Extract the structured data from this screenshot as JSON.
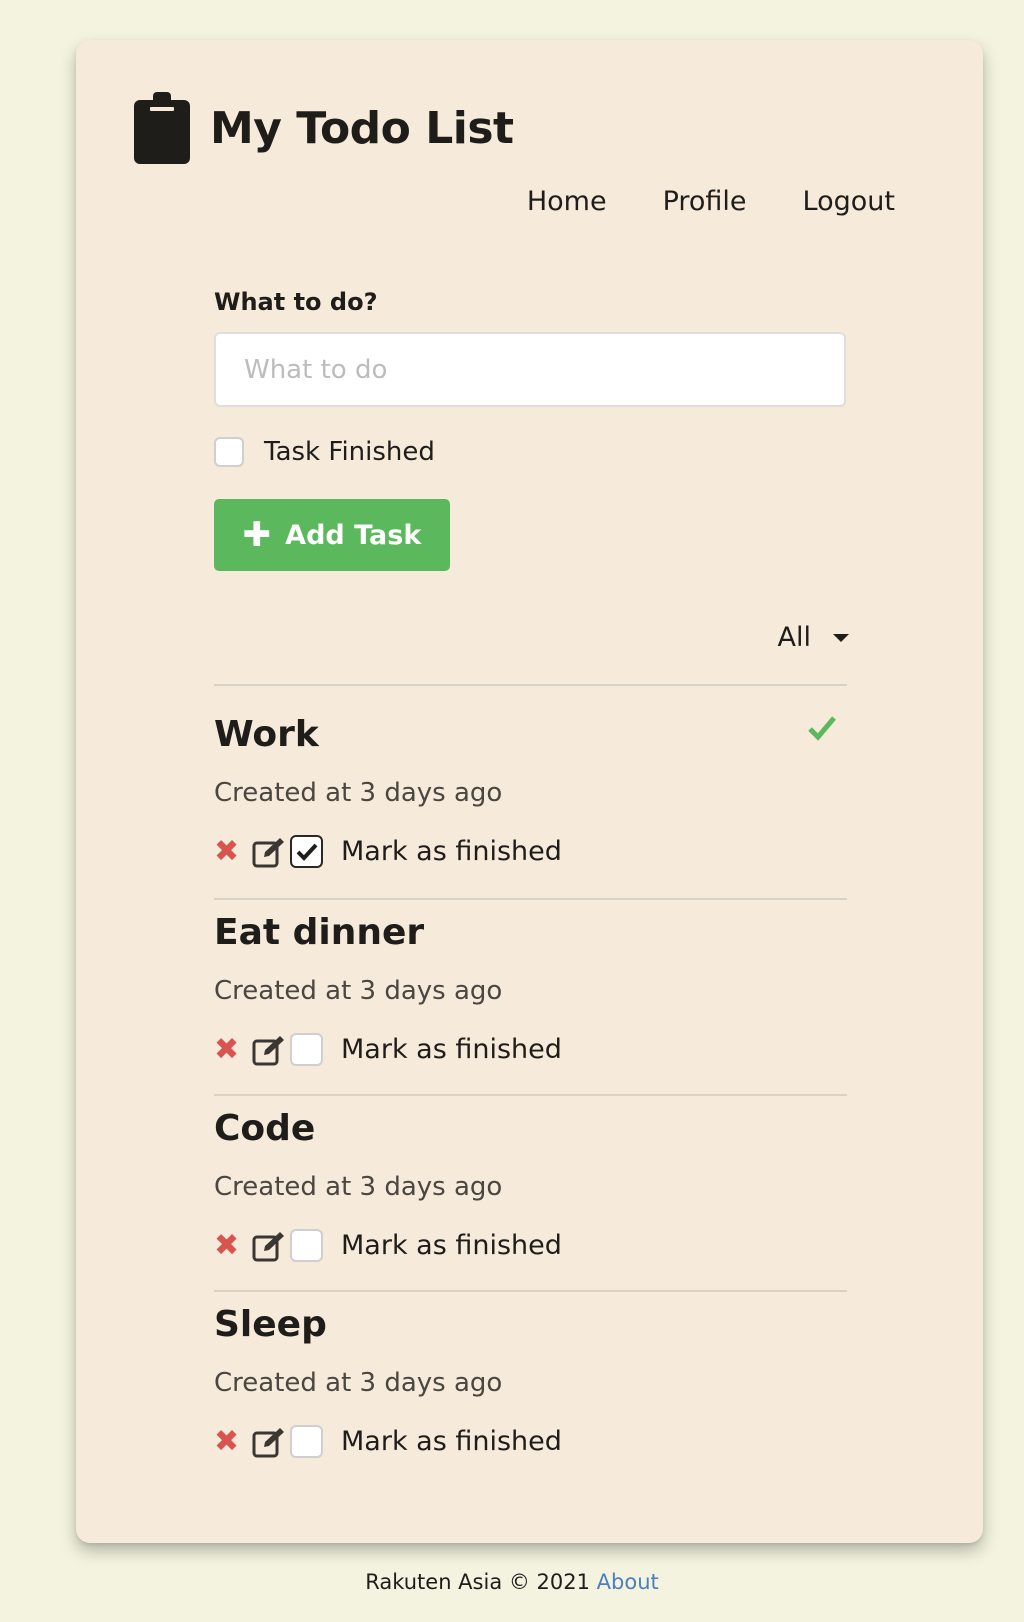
{
  "app": {
    "title": "My Todo List"
  },
  "nav": {
    "home": "Home",
    "profile": "Profile",
    "logout": "Logout"
  },
  "form": {
    "label": "What to do?",
    "placeholder": "What to do",
    "finished_label": "Task Finished",
    "finished_checked": false,
    "add_button": "Add Task",
    "add_icon": "plus-icon",
    "add_button_color": "#5cb85c"
  },
  "filter": {
    "selected": "All"
  },
  "tasks": [
    {
      "title": "Work",
      "created": "Created at 3 days ago",
      "finished": true,
      "mark_label": "Mark as finished"
    },
    {
      "title": "Eat dinner",
      "created": "Created at 3 days ago",
      "finished": false,
      "mark_label": "Mark as finished"
    },
    {
      "title": "Code",
      "created": "Created at 3 days ago",
      "finished": false,
      "mark_label": "Mark as finished"
    },
    {
      "title": "Sleep",
      "created": "Created at 3 days ago",
      "finished": false,
      "mark_label": "Mark as finished"
    }
  ],
  "icons": {
    "brand": "clipboard-icon",
    "delete": "delete-x-icon",
    "edit": "edit-icon",
    "done": "checkmark-icon"
  },
  "colors": {
    "background": "#f3f3df",
    "card": "#f6eadb",
    "delete": "#d9534f",
    "done": "#5cb85c",
    "link": "#4a7fc1"
  },
  "footer": {
    "text": "Rakuten Asia © 2021 ",
    "about_link": "About"
  }
}
